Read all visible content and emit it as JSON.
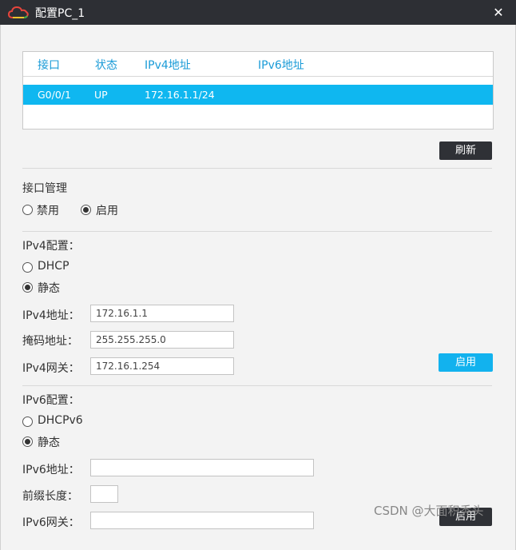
{
  "window": {
    "title": "配置PC_1",
    "close_glyph": "✕",
    "icon": "cloud-logo-icon"
  },
  "interfaces": {
    "headers": [
      "接口",
      "状态",
      "IPv4地址",
      "IPv6地址"
    ],
    "rows": [
      {
        "iface": "G0/0/1",
        "status": "UP",
        "ipv4": "172.16.1.1/24",
        "ipv6": ""
      }
    ],
    "selected_color": "#0fb7f0",
    "refresh_label": "刷新"
  },
  "iface_mgmt": {
    "title": "接口管理",
    "disable_label": "禁用",
    "enable_label": "启用",
    "selected": "enable"
  },
  "ipv4": {
    "title": "IPv4配置：",
    "dhcp_label": "DHCP",
    "static_label": "静态",
    "mode": "static",
    "addr_label": "IPv4地址：",
    "addr_value": "172.16.1.1",
    "mask_label": "掩码地址：",
    "mask_value": "255.255.255.0",
    "gw_label": "IPv4网关：",
    "gw_value": "172.16.1.254",
    "apply_label": "启用"
  },
  "ipv6": {
    "title": "IPv6配置：",
    "dhcp_label": "DHCPv6",
    "static_label": "静态",
    "mode": "static",
    "addr_label": "IPv6地址：",
    "addr_value": "",
    "prefix_label": "前缀长度：",
    "prefix_value": "",
    "gw_label": "IPv6网关：",
    "gw_value": "",
    "apply_label": "启用"
  },
  "watermark": "CSDN @大面积秃头"
}
